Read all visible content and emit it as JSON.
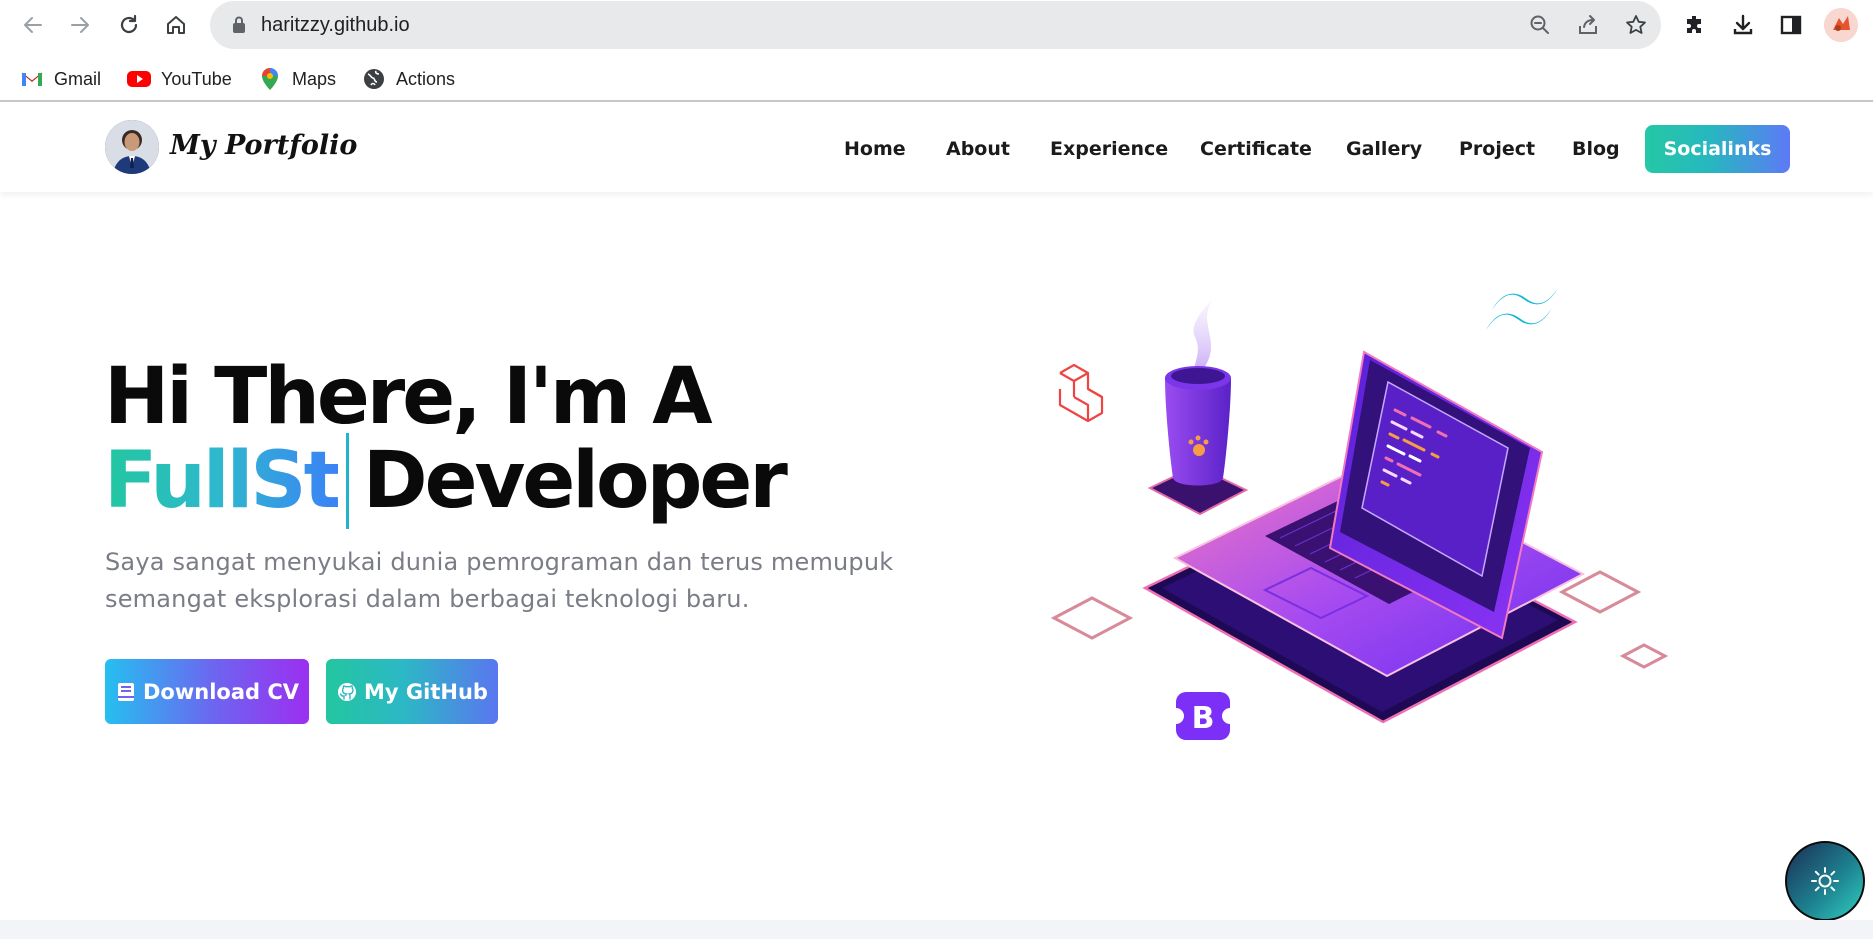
{
  "browser": {
    "url": "haritzzy.github.io",
    "bookmarks": [
      {
        "label": "Gmail",
        "icon": "gmail-icon"
      },
      {
        "label": "YouTube",
        "icon": "youtube-icon"
      },
      {
        "label": "Maps",
        "icon": "maps-icon"
      },
      {
        "label": "Actions",
        "icon": "globe-icon"
      }
    ]
  },
  "header": {
    "brand": "My Portfolio",
    "nav": [
      "Home",
      "About",
      "Experience",
      "Certificate",
      "Gallery",
      "Project",
      "Blog"
    ],
    "cta": "Socialinks"
  },
  "hero": {
    "line1": "Hi There, I'm A",
    "typed": "FullSt",
    "line2_rest": "Developer",
    "description": "Saya sangat menyukai dunia pemrograman dan terus memupuk semangat eksplorasi dalam berbagai teknologi baru.",
    "btn_cv": "Download CV",
    "btn_github": "My GitHub"
  },
  "colors": {
    "accent_gradient_start": "#22c7a0",
    "accent_gradient_end": "#5e79f6",
    "cv_gradient_end": "#9b2ff0",
    "laptop_purple": "#7b2ff7"
  }
}
